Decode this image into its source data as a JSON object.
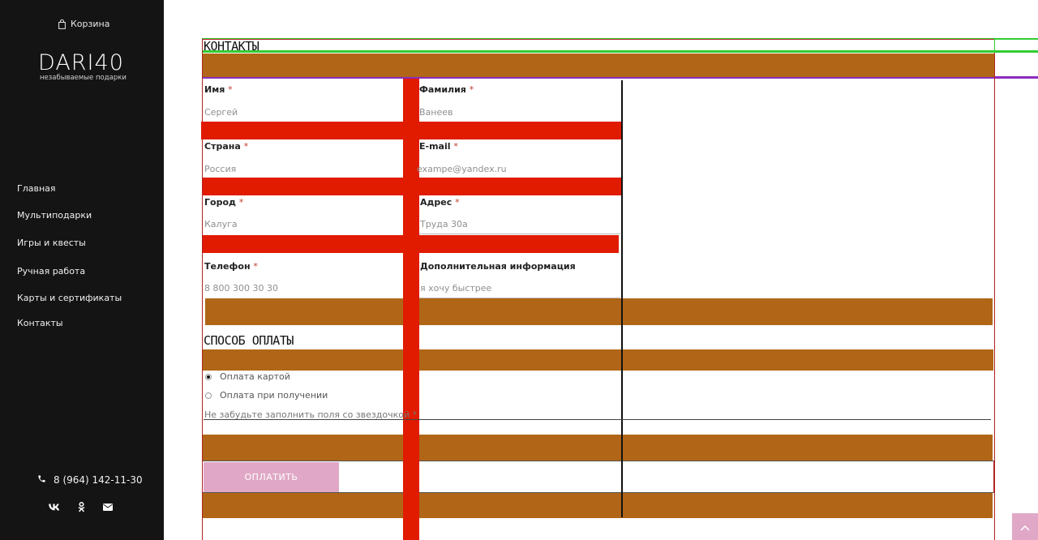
{
  "sidebar": {
    "cart_label": "Корзина",
    "logo": "DARI40",
    "tagline": "незабываемые подарки",
    "nav": [
      "Главная",
      "Мультиподарки",
      "Игры и квесты",
      "Ручная работа",
      "Карты и сертификаты",
      "Контакты"
    ],
    "phone": "8 (964) 142-11-30",
    "socials": [
      "vk-icon",
      "odnoklassniki-icon",
      "mail-icon"
    ]
  },
  "form": {
    "contacts_title": "КОНТАКТЫ",
    "first_name": {
      "label": "Имя",
      "required": "*",
      "placeholder": "Сергей"
    },
    "last_name": {
      "label": "Фамилия",
      "required": "*",
      "placeholder": "Ванеев"
    },
    "country": {
      "label": "Страна",
      "required": "*",
      "placeholder": "Россия"
    },
    "email": {
      "label": "E-mail",
      "required": "*",
      "placeholder": "exampe@yandex.ru"
    },
    "city": {
      "label": "Город",
      "required": "*",
      "placeholder": "Калуга"
    },
    "address": {
      "label": "Адрес",
      "required": "*",
      "placeholder": "Труда 30а"
    },
    "phone": {
      "label": "Телефон",
      "required": "*",
      "placeholder": "8 800 300 30 30"
    },
    "extra": {
      "label": "Дополнительная информация",
      "placeholder": "я хочу быстрее"
    },
    "payment_title": "СПОСОБ ОПЛАТЫ",
    "payment_options": [
      "Оплата картой",
      "Оплата при получении"
    ],
    "selected_payment": "Оплата картой",
    "reminder": "Не забудьте заполнить поля со звездочкой *",
    "pay_button": "ОПЛАТИТЬ"
  },
  "colors": {
    "sidebar_bg": "#141414",
    "debug_red": "#e01b00",
    "debug_brown": "#b06616",
    "debug_green": "#33cc33",
    "debug_purple": "#8a2bbf",
    "pay_button": "#e0a8c6"
  }
}
